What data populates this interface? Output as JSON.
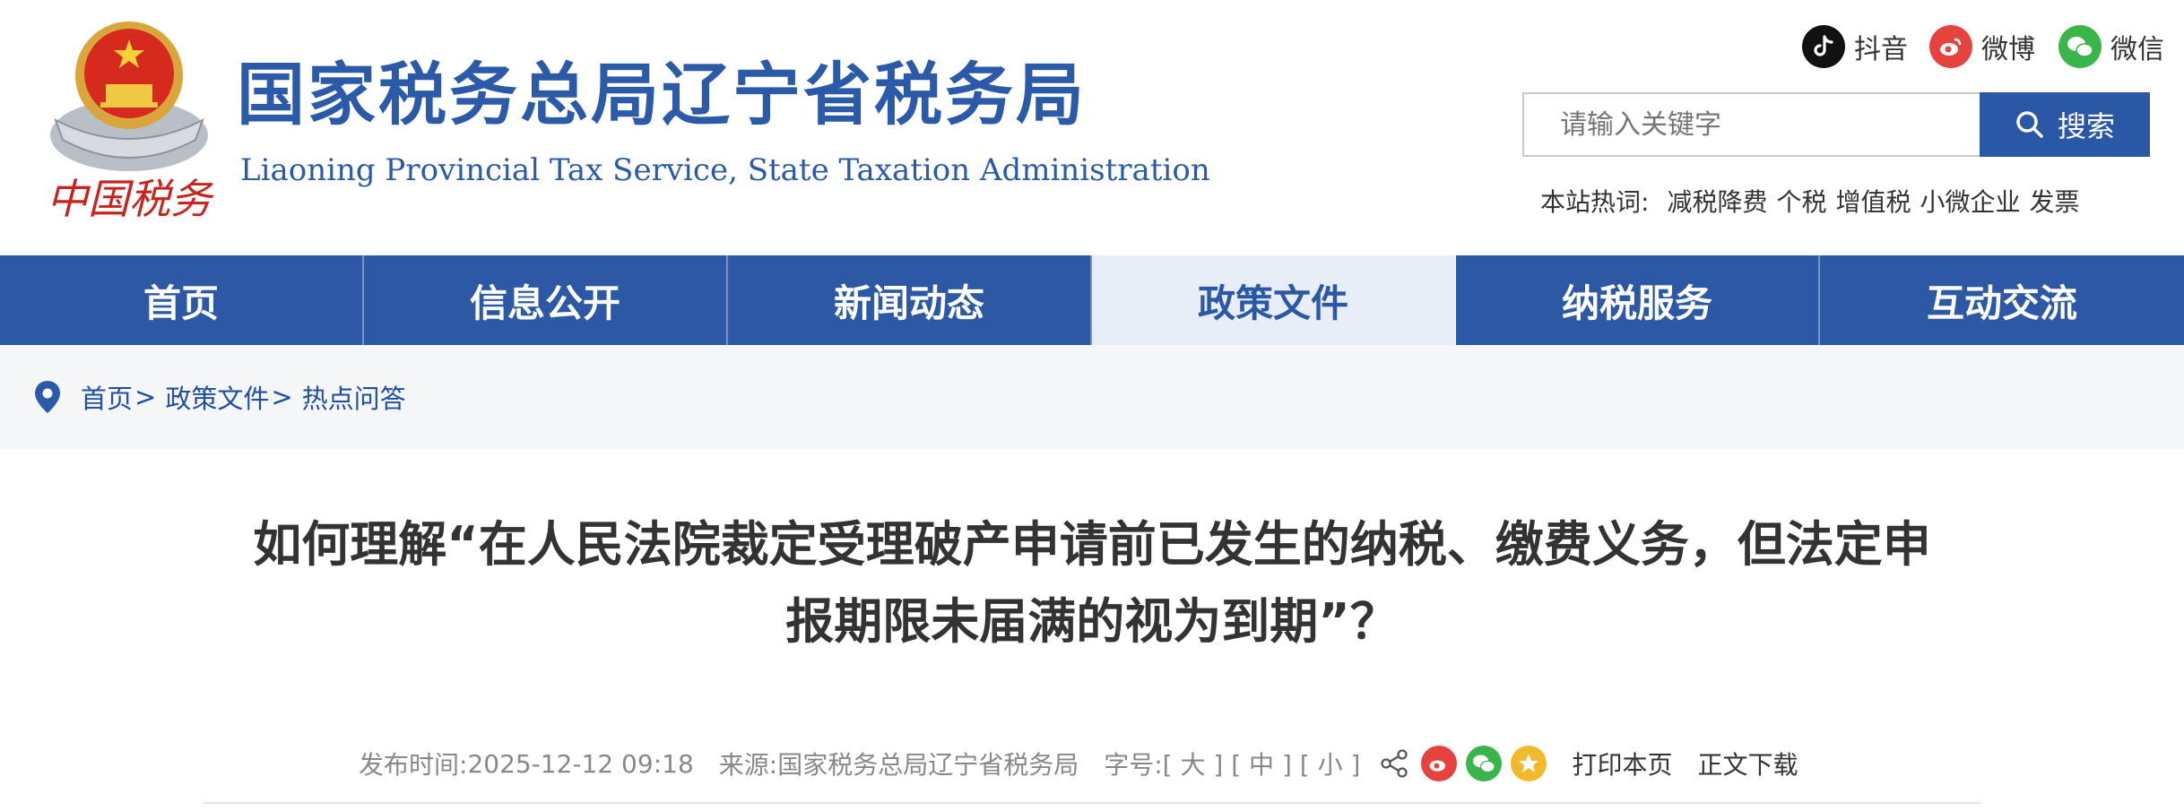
{
  "header": {
    "site_title": "国家税务总局辽宁省税务局",
    "site_subtitle": "Liaoning Provincial Tax Service, State Taxation Administration",
    "emblem_text": "中国税务",
    "social": [
      {
        "label": "抖音",
        "icon": "douyin-icon",
        "color": "#111111"
      },
      {
        "label": "微博",
        "icon": "weibo-icon",
        "color": "#e6433f"
      },
      {
        "label": "微信",
        "icon": "wechat-icon",
        "color": "#3ab54a"
      }
    ],
    "search": {
      "placeholder": "请输入关键字",
      "button_label": "搜索"
    },
    "hot": {
      "label": "本站热词:",
      "items": [
        "减税降费",
        "个税",
        "增值税",
        "小微企业",
        "发票"
      ]
    }
  },
  "nav": {
    "items": [
      "首页",
      "信息公开",
      "新闻动态",
      "政策文件",
      "纳税服务",
      "互动交流"
    ],
    "active_index": 3
  },
  "breadcrumb": {
    "items": [
      "首页",
      "政策文件",
      "热点问答"
    ],
    "separator": ">"
  },
  "article": {
    "title_line1": "如何理解“在人民法院裁定受理破产申请前已发生的纳税、缴费义务，但法定申",
    "title_line2": "报期限未届满的视为到期”？",
    "meta": {
      "publish_label": "发布时间:",
      "publish_time": "2025-12-12 09:18",
      "source_label": "来源:",
      "source": "国家税务总局辽宁省税务局",
      "font_label": "字号:",
      "font_large": "[ 大 ]",
      "font_medium": "[ 中 ]",
      "font_small": "[ 小 ]",
      "print_label": "打印本页",
      "download_label": "正文下载"
    }
  },
  "colors": {
    "brand_blue": "#2c58a5",
    "active_tab_bg": "#e8eef8"
  }
}
